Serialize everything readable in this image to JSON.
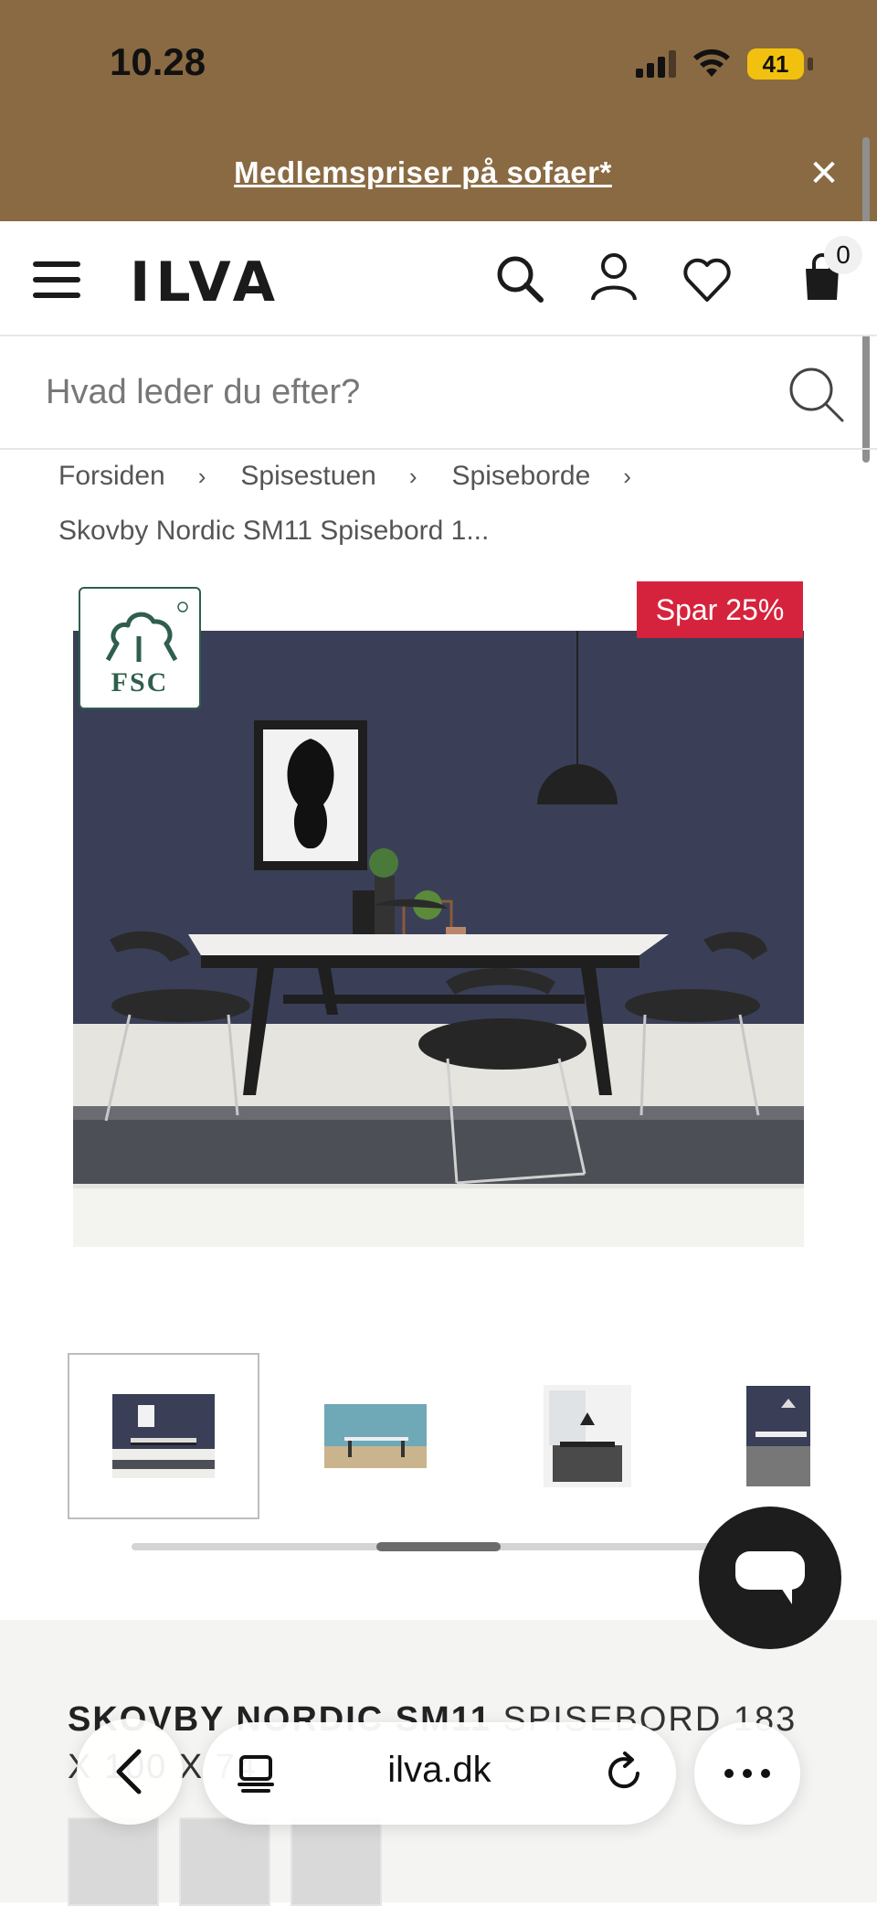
{
  "status_bar": {
    "time": "10.28",
    "battery": "41"
  },
  "promo": {
    "text": "Medlemspriser på sofaer*",
    "close": "✕"
  },
  "header": {
    "logo": "ILVA",
    "cart_count": "0"
  },
  "search": {
    "placeholder": "Hvad leder du efter?"
  },
  "breadcrumb": {
    "items": [
      "Forsiden",
      "Spisestuen",
      "Spiseborde"
    ],
    "separator": "›",
    "current": "Skovby Nordic SM11 Spisebord 1..."
  },
  "product": {
    "badge": "Spar 25%",
    "fsc_label": "FSC",
    "title_bold": "SKOVBY NORDIC SM11",
    "title_rest": "SPISEBORD 183 X 100 X 74"
  },
  "browser": {
    "url": "ilva.dk"
  },
  "colors": {
    "promo_bg": "#8a6a43",
    "sale_red": "#d6233d",
    "wall": "#3a3f57"
  }
}
